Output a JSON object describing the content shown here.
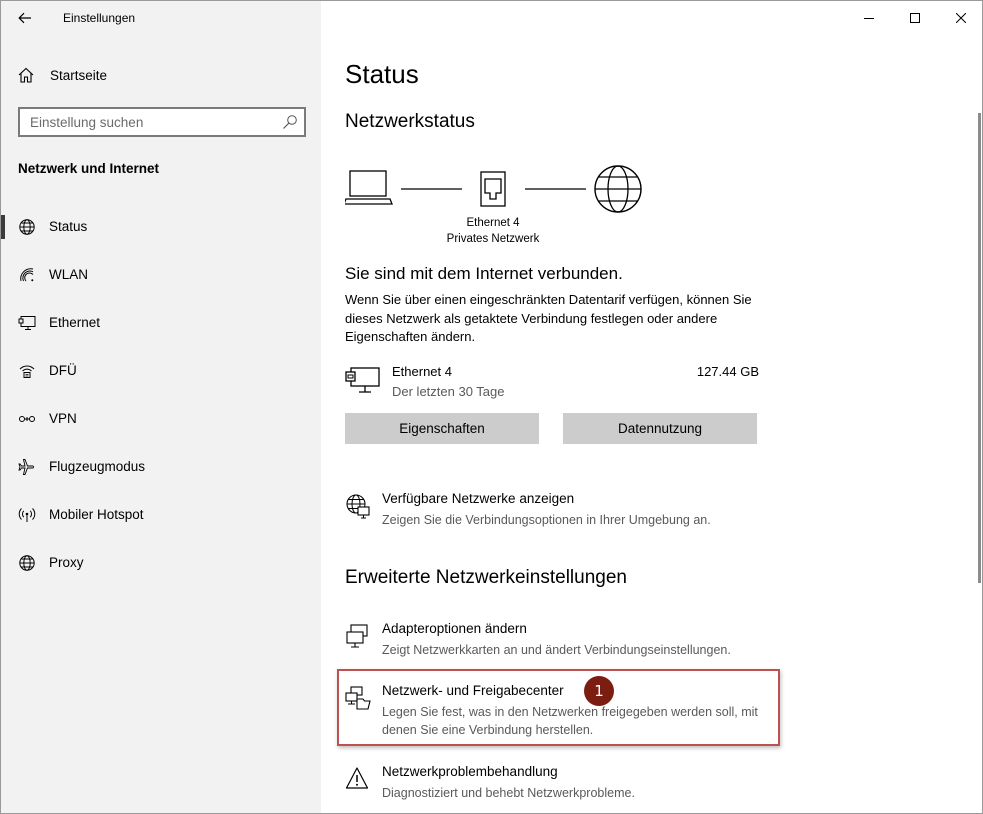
{
  "window": {
    "title": "Einstellungen",
    "caption": {
      "minimize": "minimize",
      "maximize": "maximize",
      "close": "close"
    }
  },
  "sidebar": {
    "home_label": "Startseite",
    "search_placeholder": "Einstellung suchen",
    "section_label": "Netzwerk und Internet",
    "items": [
      {
        "label": "Status",
        "icon": "globe-icon",
        "active": true
      },
      {
        "label": "WLAN",
        "icon": "wifi-icon",
        "active": false
      },
      {
        "label": "Ethernet",
        "icon": "ethernet-icon",
        "active": false
      },
      {
        "label": "DFÜ",
        "icon": "dialup-icon",
        "active": false
      },
      {
        "label": "VPN",
        "icon": "vpn-icon",
        "active": false
      },
      {
        "label": "Flugzeugmodus",
        "icon": "airplane-icon",
        "active": false
      },
      {
        "label": "Mobiler Hotspot",
        "icon": "hotspot-icon",
        "active": false
      },
      {
        "label": "Proxy",
        "icon": "globe-icon",
        "active": false
      }
    ]
  },
  "main": {
    "title": "Status",
    "network_status_heading": "Netzwerkstatus",
    "adapter_name": "Ethernet 4",
    "network_type": "Privates Netzwerk",
    "connected_heading": "Sie sind mit dem Internet verbunden.",
    "description": "Wenn Sie über einen eingeschränkten Datentarif verfügen, können Sie dieses Netzwerk als getaktete Verbindung festlegen oder andere Eigenschaften ändern.",
    "connection": {
      "name": "Ethernet 4",
      "period": "Der letzten 30 Tage",
      "usage": "127.44 GB"
    },
    "buttons": {
      "properties": "Eigenschaften",
      "data_usage": "Datennutzung"
    },
    "available_networks": {
      "title": "Verfügbare Netzwerke anzeigen",
      "subtitle": "Zeigen Sie die Verbindungsoptionen in Ihrer Umgebung an."
    },
    "advanced_heading": "Erweiterte Netzwerkeinstellungen",
    "advanced_items": [
      {
        "title": "Adapteroptionen ändern",
        "subtitle": "Zeigt Netzwerkkarten an und ändert Verbindungseinstellungen."
      },
      {
        "title": "Netzwerk- und Freigabecenter",
        "subtitle": "Legen Sie fest, was in den Netzwerken freigegeben werden soll, mit denen Sie eine Verbindung herstellen."
      },
      {
        "title": "Netzwerkproblembehandlung",
        "subtitle": "Diagnostiziert und behebt Netzwerkprobleme."
      }
    ],
    "annotation_badge": "1",
    "highlight_color": "#c0504d",
    "badge_color": "#7b1d10"
  }
}
